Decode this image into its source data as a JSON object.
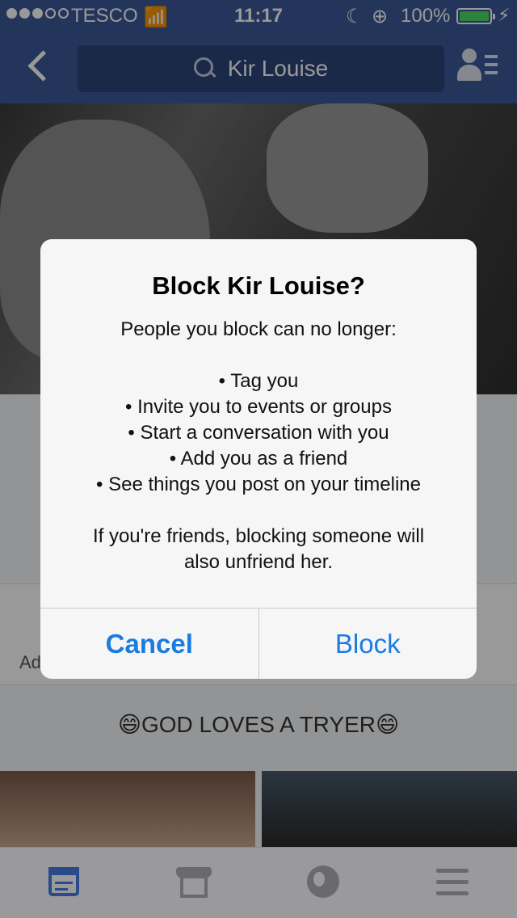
{
  "status_bar": {
    "carrier": "TESCO",
    "time": "11:17",
    "battery_percent": "100%"
  },
  "navbar": {
    "search_text": "Kir Louise"
  },
  "profile": {
    "action_partial": "Ad",
    "motto": "😄GOD LOVES A TRYER😄"
  },
  "alert": {
    "title": "Block Kir Louise?",
    "intro": "People you block can no longer:",
    "items": [
      "• Tag you",
      "• Invite you to events or groups",
      "• Start a conversation with you",
      "• Add you as a friend",
      "• See things you post on your timeline"
    ],
    "footer_line1": "If you're friends, blocking someone will",
    "footer_line2": "also unfriend her.",
    "cancel_label": "Cancel",
    "block_label": "Block"
  },
  "colors": {
    "nav_blue": "#3b5998",
    "ios_blue": "#1a7ce0",
    "battery_green": "#4cd964"
  },
  "icons": [
    "back-chevron-icon",
    "search-icon",
    "friend-requests-icon",
    "news-feed-icon",
    "marketplace-icon",
    "globe-icon",
    "more-menu-icon"
  ]
}
